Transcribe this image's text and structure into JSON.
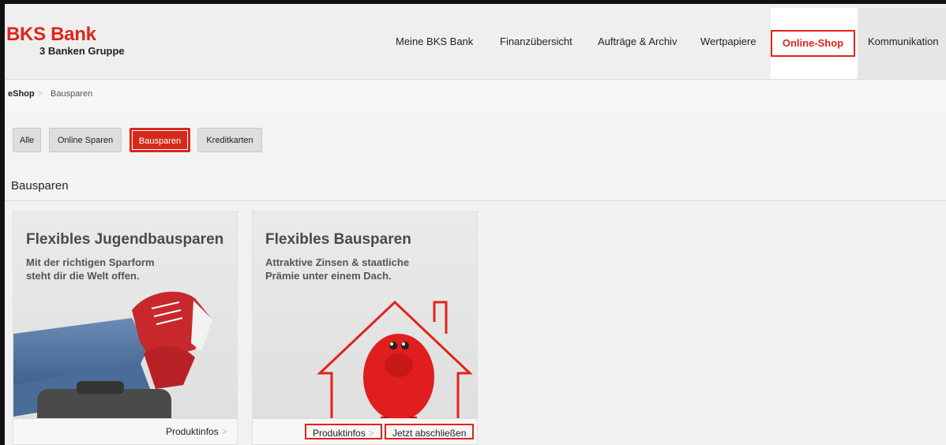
{
  "logo": {
    "main": "BKS Bank",
    "sub": "3 Banken Gruppe"
  },
  "nav": {
    "items": [
      "Meine BKS Bank",
      "Finanzübersicht",
      "Aufträge & Archiv",
      "Wertpapiere",
      "Online-Shop",
      "Kommunikation"
    ],
    "active": "Online-Shop"
  },
  "breadcrumb": {
    "root": "eShop",
    "separator": ">",
    "current": "Bausparen"
  },
  "filters": {
    "items": [
      "Alle",
      "Online Sparen",
      "Bausparen",
      "Kreditkarten"
    ],
    "active": "Bausparen"
  },
  "section": {
    "title": "Bausparen"
  },
  "cards": [
    {
      "title": "Flexibles Jugendbausparen",
      "subtitle_line1": "Mit der richtigen Sparform",
      "subtitle_line2": "steht dir die Welt offen.",
      "footer_links": [
        "Produktinfos"
      ]
    },
    {
      "title": "Flexibles Bausparen",
      "subtitle_line1": "Attraktive Zinsen & staatliche",
      "subtitle_line2": "Prämie unter einem Dach.",
      "footer_links": [
        "Produktinfos",
        "Jetzt abschließen"
      ]
    }
  ],
  "chevron": ">",
  "colors": {
    "brand_red": "#e2231a",
    "active_filter": "#d42a1c"
  }
}
